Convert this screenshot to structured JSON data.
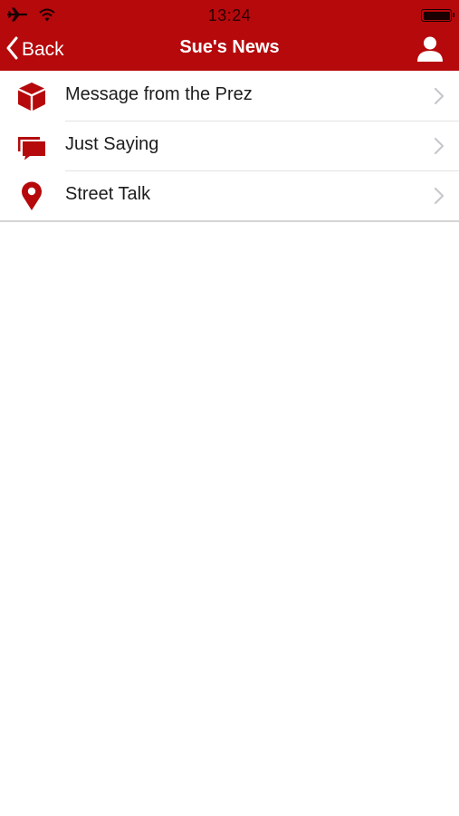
{
  "status_bar": {
    "time": "13:24",
    "icons": [
      "airplane-icon",
      "wifi-icon",
      "battery-icon"
    ]
  },
  "nav": {
    "back_label": "Back",
    "title": "Sue's News",
    "right_icon": "user-icon"
  },
  "menu": {
    "items": [
      {
        "label": "Message from the Prez",
        "icon": "cube-icon"
      },
      {
        "label": "Just Saying",
        "icon": "chat-bubbles-icon"
      },
      {
        "label": "Street Talk",
        "icon": "map-pin-icon"
      }
    ]
  },
  "colors": {
    "brand_red": "#b5090c",
    "background": "#ffffff",
    "text": "#1c1c1c",
    "chevron": "#c7c7cc",
    "separator": "#e2e2e2"
  }
}
